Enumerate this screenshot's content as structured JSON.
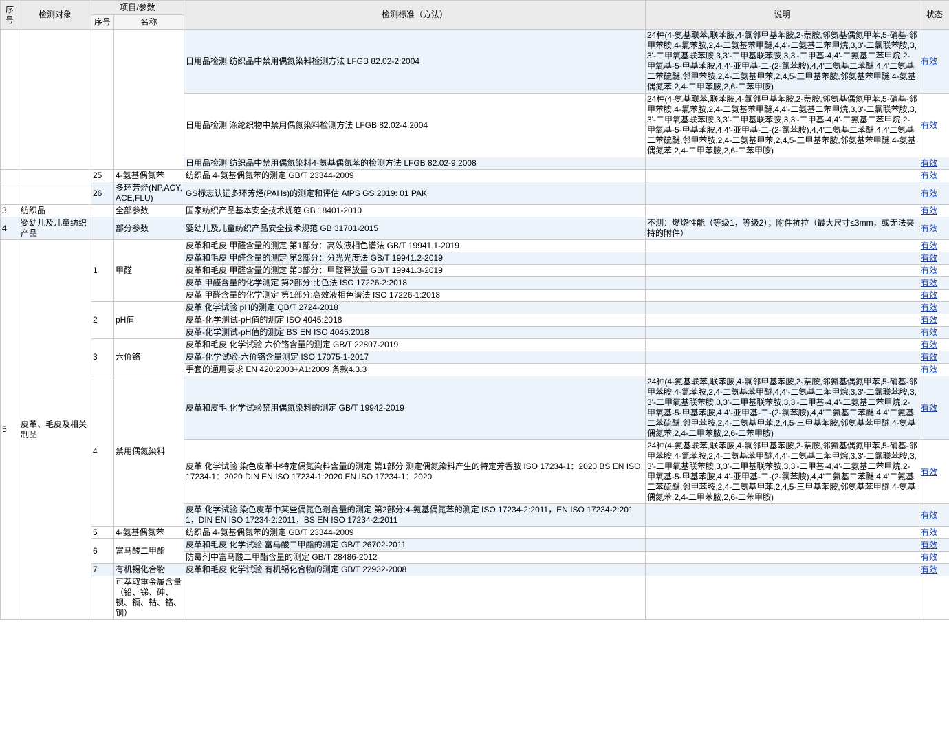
{
  "header": {
    "col_seq": "序号",
    "col_object": "检测对象",
    "col_item_group": "项目/参数",
    "col_item_no": "序号",
    "col_item_name": "名称",
    "col_standard": "检测标准（方法）",
    "col_note": "说明",
    "col_status": "状态"
  },
  "status_label": "有效",
  "azo_note": "24种(4-氨基联苯,联苯胺,4-氯邻甲基苯胺,2-萘胺,邻氨基偶氮甲苯,5-硝基-邻甲苯胺,4-氯苯胺,2,4-二氨基苯甲醚,4,4'-二氨基二苯甲烷,3,3'-二氯联苯胺,3,3'-二甲氧基联苯胺,3,3'-二甲基联苯胺,3,3'-二甲基-4,4'-二氨基二苯甲烷,2-甲氧基-5-甲基苯胺,4,4'-亚甲基-二-(2-氯苯胺),4,4'二氨基二苯醚,4,4'二氨基二苯硫醚,邻甲苯胺,2,4-二氨基甲苯,2,4,5-三甲基苯胺,邻氨基苯甲醚,4-氨基偶氮苯,2,4-二甲苯胺,2,6-二苯甲胺)",
  "rows": {
    "r1": {
      "standard": "日用品检测 纺织品中禁用偶氮染料检测方法 LFGB 82.02-2:2004"
    },
    "r2": {
      "standard": "日用品检测 涤纶织物中禁用偶氮染料检测方法 LFGB 82.02-4:2004"
    },
    "r3": {
      "standard": "日用品检测 纺织品中禁用偶氮染料4-氨基偶氮苯的检测方法 LFGB 82.02-9:2008"
    },
    "r4": {
      "item_no": "25",
      "item_name": "4-氨基偶氮苯",
      "standard": "纺织品 4-氨基偶氮苯的测定 GB/T 23344-2009"
    },
    "r5": {
      "item_no": "26",
      "item_name": "多环芳烃(NP,ACY,ACE,FLU)",
      "standard": "GS标志认证多环芳烃(PAHs)的测定和评估 AfPS GS 2019: 01 PAK"
    },
    "r6": {
      "seq": "3",
      "object": "纺织品",
      "item_name": "全部参数",
      "standard": "国家纺织产品基本安全技术规范 GB 18401-2010"
    },
    "r7": {
      "seq": "4",
      "object": "婴幼儿及儿童纺织产品",
      "item_name": "部分参数",
      "standard": "婴幼儿及儿童纺织产品安全技术规范 GB 31701-2015",
      "note": "不测：燃烧性能（等级1，等级2）；附件抗拉（最大尺寸≤3mm，或无法夹持的附件）"
    },
    "g5": {
      "seq": "5",
      "object": "皮革、毛皮及相关制品"
    },
    "g1": {
      "item_no": "1",
      "item_name": "甲醛"
    },
    "r8": {
      "standard": "皮革和毛皮 甲醛含量的测定 第1部分：高效液相色谱法 GB/T 19941.1-2019"
    },
    "r9": {
      "standard": "皮革和毛皮 甲醛含量的测定 第2部分：分光光度法 GB/T 19941.2-2019"
    },
    "r10": {
      "standard": "皮革和毛皮 甲醛含量的测定 第3部分：甲醛释放量 GB/T 19941.3-2019"
    },
    "r11": {
      "standard": "皮革 甲醛含量的化学测定 第2部分:比色法 ISO 17226-2:2018"
    },
    "r12": {
      "standard": "皮革 甲醛含量的化学测定 第1部分:高效液相色谱法 ISO 17226-1:2018"
    },
    "g2": {
      "item_no": "2",
      "item_name": "pH值"
    },
    "r13": {
      "standard": "皮革 化学试验 pH的测定 QB/T 2724-2018"
    },
    "r14": {
      "standard": "皮革-化学测试-pH值的测定 ISO 4045:2018"
    },
    "r15": {
      "standard": "皮革-化学测试-pH值的测定 BS EN ISO 4045:2018"
    },
    "g3": {
      "item_no": "3",
      "item_name": "六价铬"
    },
    "r16": {
      "standard": "皮革和毛皮 化学试验 六价铬含量的测定 GB/T 22807-2019"
    },
    "r17": {
      "standard": "皮革-化学试验-六价铬含量测定 ISO 17075-1-2017"
    },
    "r18": {
      "standard": "手套的通用要求 EN 420:2003+A1:2009 条款4.3.3"
    },
    "g4": {
      "item_no": "4",
      "item_name": "禁用偶氮染料"
    },
    "r19": {
      "standard": "皮革和皮毛 化学试验禁用偶氮染料的测定 GB/T 19942-2019"
    },
    "r20": {
      "standard": "皮革 化学试验 染色皮革中特定偶氮染料含量的测定 第1部分 测定偶氮染料产生的特定芳香胺 ISO 17234-1：2020 BS EN ISO 17234-1：2020 DIN EN ISO 17234-1:2020 EN ISO 17234-1：2020"
    },
    "r21": {
      "standard": "皮革 化学试验 染色皮革中某些偶氮色剂含量的测定 第2部分:4-氨基偶氮苯的测定 ISO 17234-2:2011，EN ISO 17234-2:2011，DIN EN ISO 17234-2:2011，BS EN ISO 17234-2:2011"
    },
    "r22": {
      "item_no": "5",
      "item_name": "4-氨基偶氮苯",
      "standard": "纺织品 4-氨基偶氮苯的测定 GB/T 23344-2009"
    },
    "g6": {
      "item_no": "6",
      "item_name": "富马酸二甲酯"
    },
    "r23": {
      "standard": "皮革和毛皮 化学试验 富马酸二甲酯的测定 GB/T 26702-2011"
    },
    "r24": {
      "standard": "防霉剂中富马酸二甲酯含量的测定 GB/T 28486-2012"
    },
    "r25": {
      "item_no": "7",
      "item_name": "有机锡化合物",
      "standard": "皮革和毛皮 化学试验 有机锡化合物的测定 GB/T 22932-2008"
    },
    "r26": {
      "item_name": "可萃取重金属含量（铅、锑、砷、钡、镉、钴、铬、铜）"
    }
  }
}
